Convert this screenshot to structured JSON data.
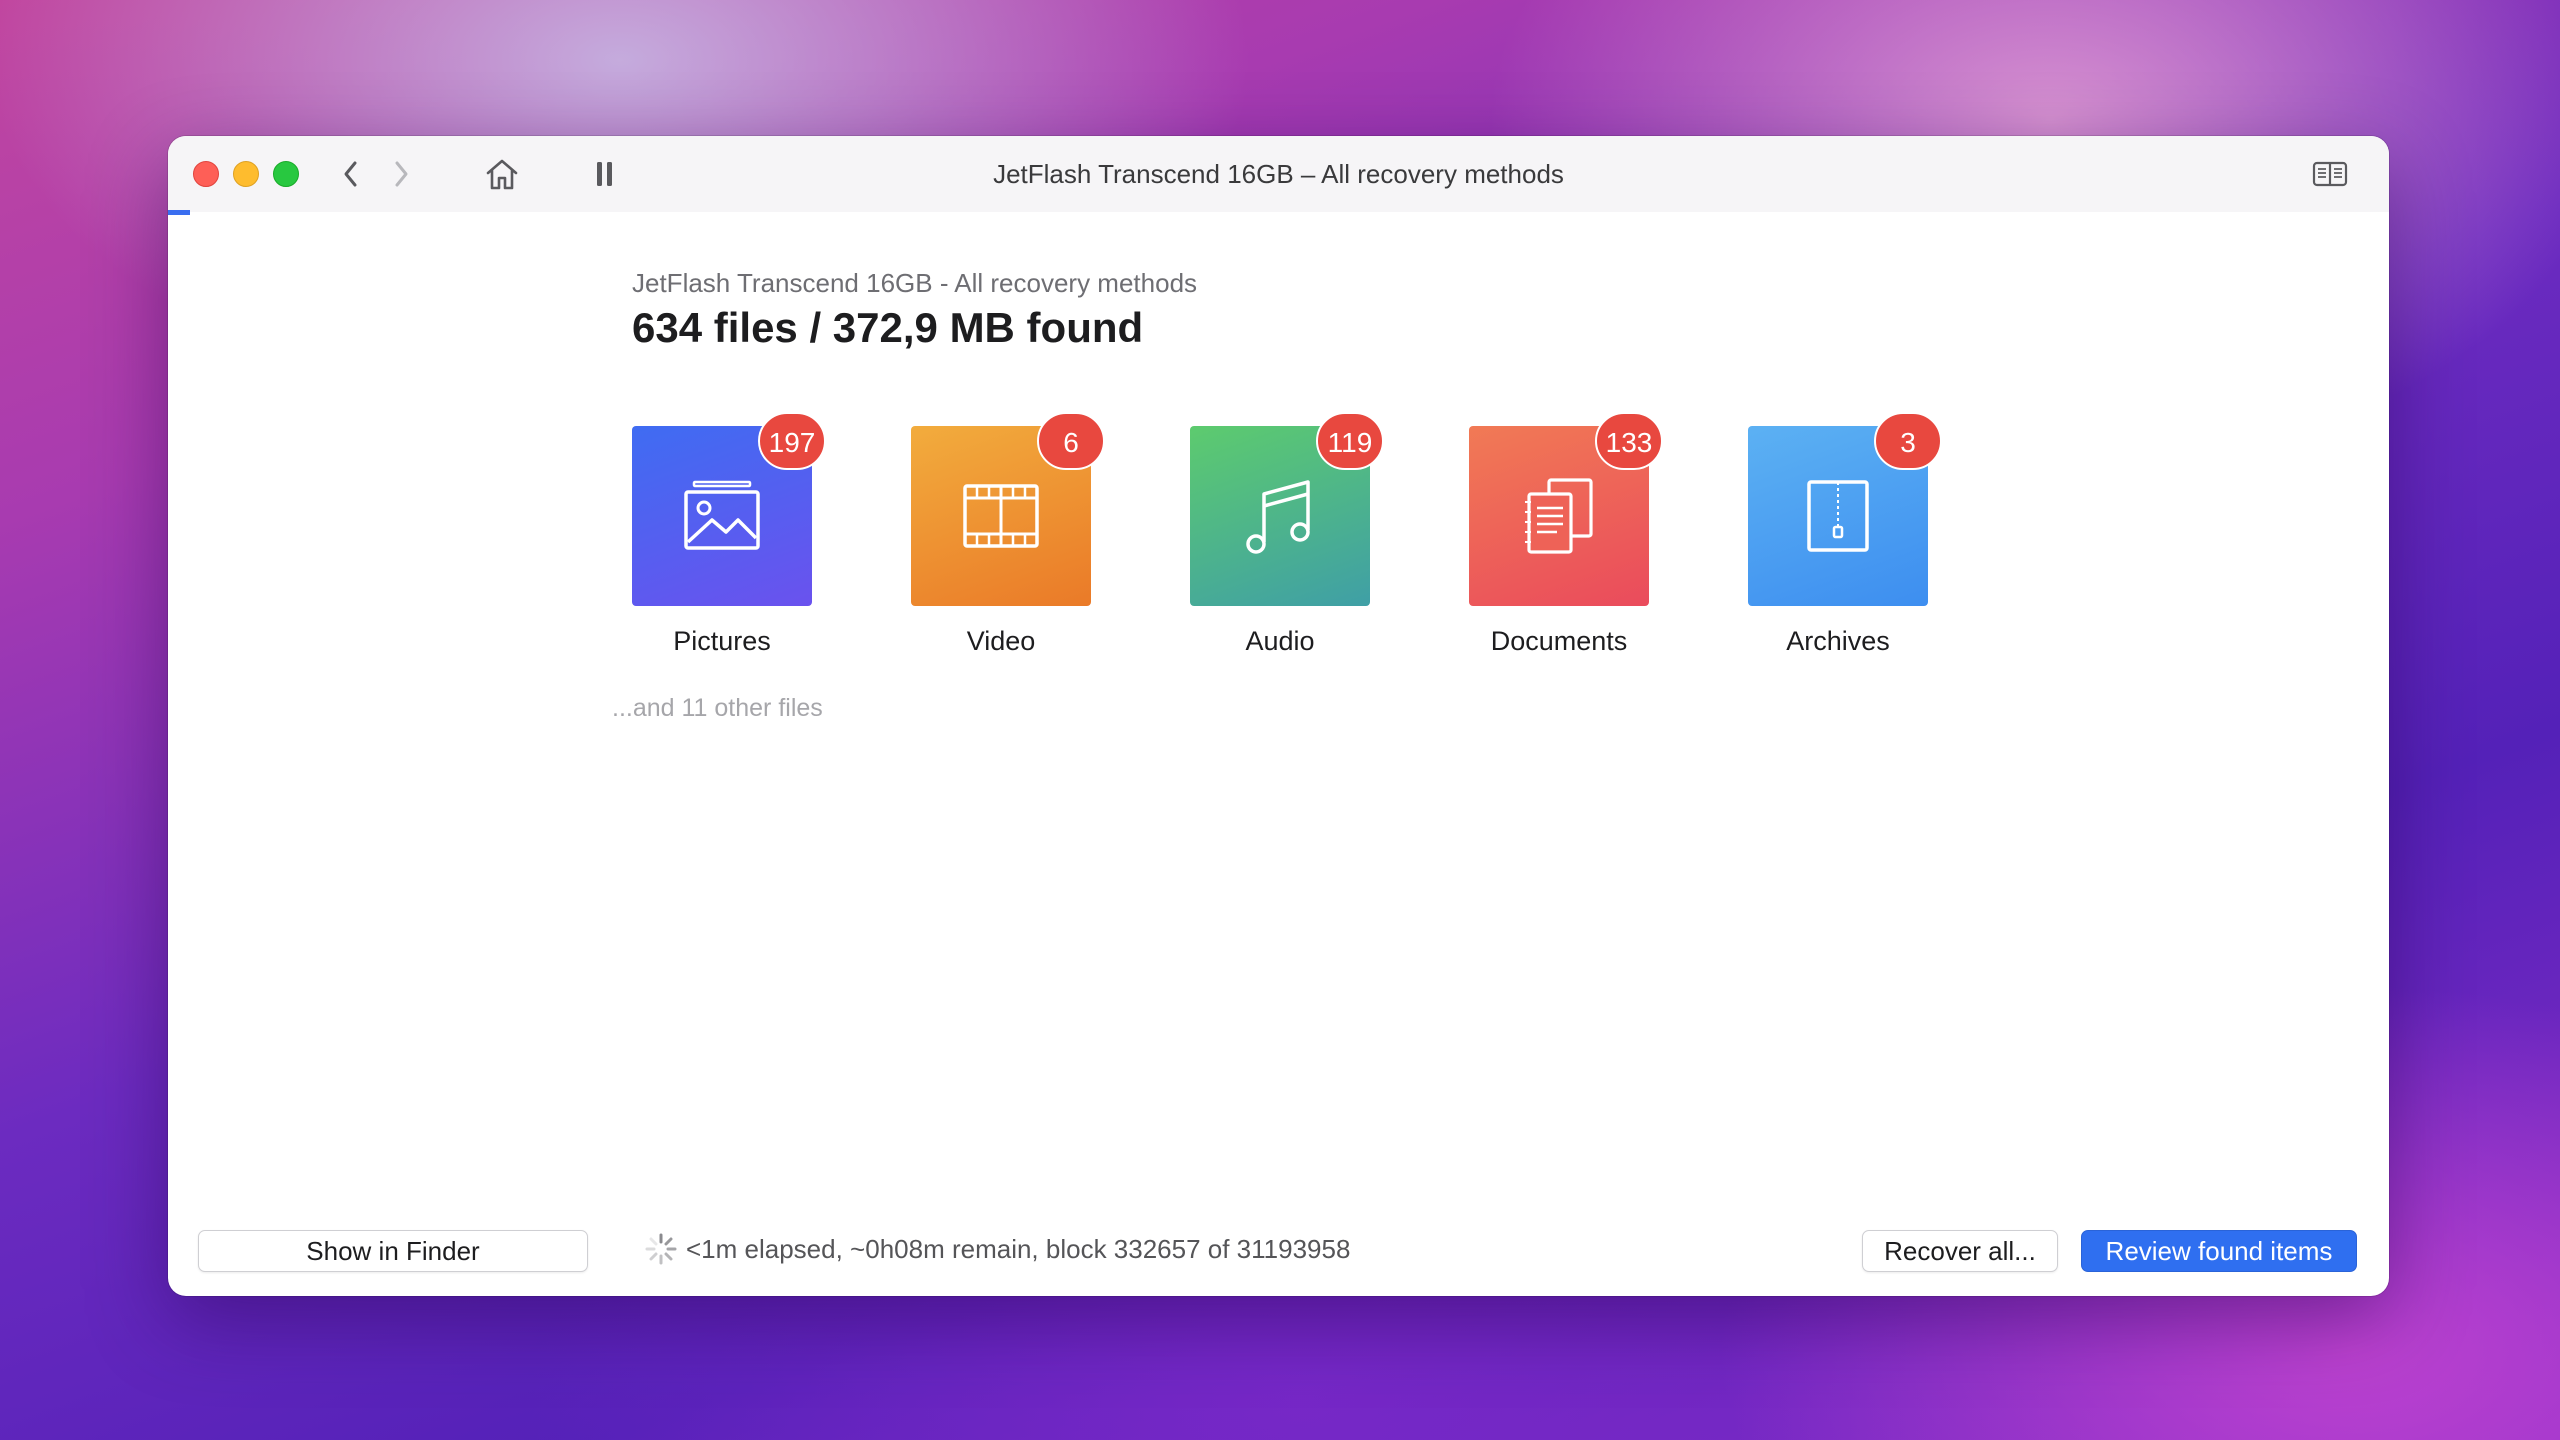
{
  "window": {
    "title": "JetFlash Transcend 16GB – All recovery methods"
  },
  "toolbar": {
    "back_icon": "chevron-left-icon",
    "forward_icon": "chevron-right-icon",
    "home_icon": "home-icon",
    "pause_icon": "pause-icon",
    "sidebar_icon": "sidebar-toggle-icon"
  },
  "header": {
    "subtitle": "JetFlash Transcend 16GB - All recovery methods",
    "summary": "634 files / 372,9 MB found"
  },
  "categories": [
    {
      "label": "Pictures",
      "count": "197",
      "icon": "picture-icon",
      "gradient": [
        "#3f6cf2",
        "#6a52ee"
      ]
    },
    {
      "label": "Video",
      "count": "6",
      "icon": "film-icon",
      "gradient": [
        "#f2ac3d",
        "#ea7a28"
      ]
    },
    {
      "label": "Audio",
      "count": "119",
      "icon": "music-note-icon",
      "gradient": [
        "#5dcb6e",
        "#3f9fa6"
      ]
    },
    {
      "label": "Documents",
      "count": "133",
      "icon": "documents-icon",
      "gradient": [
        "#f17a55",
        "#ea4b5c"
      ]
    },
    {
      "label": "Archives",
      "count": "3",
      "icon": "archive-zip-icon",
      "gradient": [
        "#5cb1f3",
        "#3d8ef0"
      ]
    }
  ],
  "other_files": "...and 11 other files",
  "footer": {
    "show_in_finder": "Show in Finder",
    "status": "<1m elapsed, ~0h08m remain, block 332657 of 31193958",
    "recover_all": "Recover all...",
    "review": "Review found items"
  },
  "colors": {
    "accent": "#2f6ff0",
    "badge": "#e8483f"
  }
}
